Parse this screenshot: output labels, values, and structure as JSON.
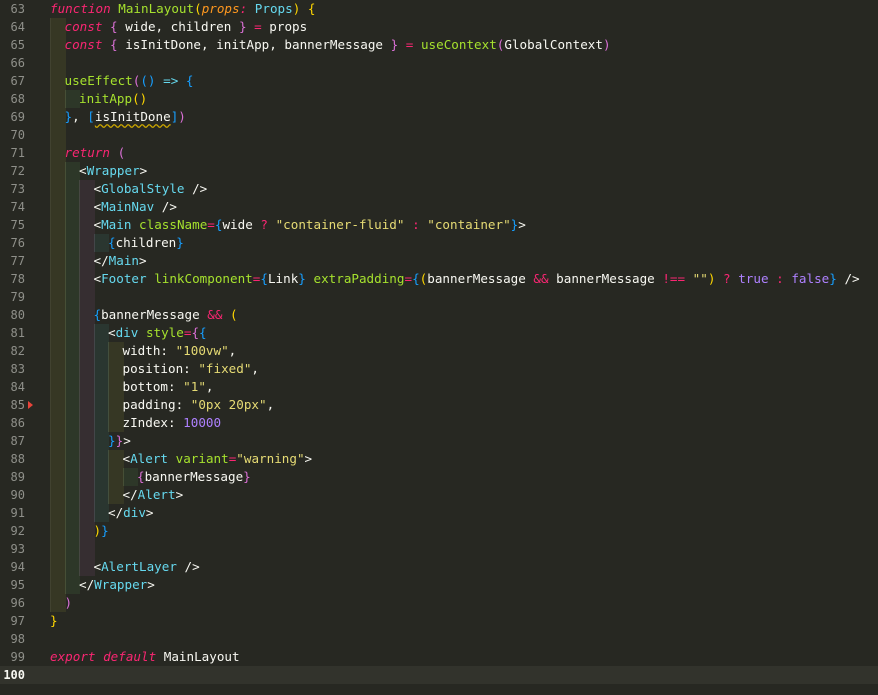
{
  "editor": {
    "theme_colors": {
      "background": "#272822",
      "keyword": "#f92672",
      "function": "#a6e22e",
      "type": "#66d9ef",
      "string": "#e6db74",
      "number": "#ae81ff",
      "parameter": "#fd971f",
      "bracket_gold": "#ffd700",
      "bracket_pink": "#da70d6",
      "bracket_blue": "#179fff"
    },
    "current_line": 100,
    "breakpoint_line": 85,
    "lines": [
      {
        "num": "63",
        "indent": 0,
        "tokens": [
          [
            "kw",
            "function"
          ],
          [
            "tx",
            " "
          ],
          [
            "fn",
            "MainLayout"
          ],
          [
            "b1",
            "("
          ],
          [
            "it",
            "props"
          ],
          [
            "kw",
            ":"
          ],
          [
            "tx",
            " "
          ],
          [
            "tn",
            "Props"
          ],
          [
            "b1",
            ")"
          ],
          [
            "tx",
            " "
          ],
          [
            "b1",
            "{"
          ]
        ]
      },
      {
        "num": "64",
        "indent": 1,
        "tokens": [
          [
            "kw",
            "const"
          ],
          [
            "tx",
            " "
          ],
          [
            "b2",
            "{"
          ],
          [
            "tx",
            " wide, children "
          ],
          [
            "b2",
            "}"
          ],
          [
            "tx",
            " "
          ],
          [
            "op",
            "="
          ],
          [
            "tx",
            " props"
          ]
        ]
      },
      {
        "num": "65",
        "indent": 1,
        "tokens": [
          [
            "kw",
            "const"
          ],
          [
            "tx",
            " "
          ],
          [
            "b2",
            "{"
          ],
          [
            "tx",
            " isInitDone, initApp, bannerMessage "
          ],
          [
            "b2",
            "}"
          ],
          [
            "tx",
            " "
          ],
          [
            "op",
            "="
          ],
          [
            "tx",
            " "
          ],
          [
            "fn",
            "useContext"
          ],
          [
            "b2",
            "("
          ],
          [
            "tx",
            "GlobalContext"
          ],
          [
            "b2",
            ")"
          ]
        ]
      },
      {
        "num": "66",
        "indent": 1,
        "tokens": []
      },
      {
        "num": "67",
        "indent": 1,
        "tokens": [
          [
            "fn",
            "useEffect"
          ],
          [
            "b2",
            "("
          ],
          [
            "b3",
            "()"
          ],
          [
            "tx",
            " "
          ],
          [
            "kwn",
            "=>"
          ],
          [
            "tx",
            " "
          ],
          [
            "b3",
            "{"
          ]
        ]
      },
      {
        "num": "68",
        "indent": 2,
        "tokens": [
          [
            "fn",
            "initApp"
          ],
          [
            "b1",
            "()"
          ]
        ]
      },
      {
        "num": "69",
        "indent": 1,
        "tokens": [
          [
            "b3",
            "}"
          ],
          [
            "tx",
            ", "
          ],
          [
            "b3",
            "["
          ],
          [
            "sq",
            "isInitDone"
          ],
          [
            "b3",
            "]"
          ],
          [
            "b2",
            ")"
          ]
        ]
      },
      {
        "num": "70",
        "indent": 1,
        "tokens": []
      },
      {
        "num": "71",
        "indent": 1,
        "tokens": [
          [
            "kw",
            "return"
          ],
          [
            "tx",
            " "
          ],
          [
            "b2",
            "("
          ]
        ]
      },
      {
        "num": "72",
        "indent": 2,
        "tokens": [
          [
            "tx",
            "<"
          ],
          [
            "tn",
            "Wrapper"
          ],
          [
            "tx",
            ">"
          ]
        ]
      },
      {
        "num": "73",
        "indent": 3,
        "tokens": [
          [
            "tx",
            "<"
          ],
          [
            "tn",
            "GlobalStyle"
          ],
          [
            "tx",
            " />"
          ]
        ]
      },
      {
        "num": "74",
        "indent": 3,
        "tokens": [
          [
            "tx",
            "<"
          ],
          [
            "tn",
            "MainNav"
          ],
          [
            "tx",
            " />"
          ]
        ]
      },
      {
        "num": "75",
        "indent": 3,
        "tokens": [
          [
            "tx",
            "<"
          ],
          [
            "tn",
            "Main"
          ],
          [
            "tx",
            " "
          ],
          [
            "fn",
            "className"
          ],
          [
            "op",
            "="
          ],
          [
            "b3",
            "{"
          ],
          [
            "tx",
            "wide "
          ],
          [
            "op",
            "?"
          ],
          [
            "tx",
            " "
          ],
          [
            "st",
            "\"container-fluid\""
          ],
          [
            "tx",
            " "
          ],
          [
            "op",
            ":"
          ],
          [
            "tx",
            " "
          ],
          [
            "st",
            "\"container\""
          ],
          [
            "b3",
            "}"
          ],
          [
            "tx",
            ">"
          ]
        ]
      },
      {
        "num": "76",
        "indent": 4,
        "tokens": [
          [
            "b3",
            "{"
          ],
          [
            "tx",
            "children"
          ],
          [
            "b3",
            "}"
          ]
        ]
      },
      {
        "num": "77",
        "indent": 3,
        "tokens": [
          [
            "tx",
            "</"
          ],
          [
            "tn",
            "Main"
          ],
          [
            "tx",
            ">"
          ]
        ]
      },
      {
        "num": "78",
        "indent": 3,
        "tokens": [
          [
            "tx",
            "<"
          ],
          [
            "tn",
            "Footer"
          ],
          [
            "tx",
            " "
          ],
          [
            "fn",
            "linkComponent"
          ],
          [
            "op",
            "="
          ],
          [
            "b3",
            "{"
          ],
          [
            "tx",
            "Link"
          ],
          [
            "b3",
            "}"
          ],
          [
            "tx",
            " "
          ],
          [
            "fn",
            "extraPadding"
          ],
          [
            "op",
            "="
          ],
          [
            "b3",
            "{"
          ],
          [
            "b1",
            "("
          ],
          [
            "tx",
            "bannerMessage "
          ],
          [
            "op",
            "&&"
          ],
          [
            "tx",
            " bannerMessage "
          ],
          [
            "op",
            "!=="
          ],
          [
            "tx",
            " "
          ],
          [
            "st",
            "\"\""
          ],
          [
            "b1",
            ")"
          ],
          [
            "tx",
            " "
          ],
          [
            "op",
            "?"
          ],
          [
            "tx",
            " "
          ],
          [
            "nm",
            "true"
          ],
          [
            "tx",
            " "
          ],
          [
            "op",
            ":"
          ],
          [
            "tx",
            " "
          ],
          [
            "nm",
            "false"
          ],
          [
            "b3",
            "}"
          ],
          [
            "tx",
            " />"
          ]
        ]
      },
      {
        "num": "79",
        "indent": 3,
        "tokens": []
      },
      {
        "num": "80",
        "indent": 3,
        "tokens": [
          [
            "b3",
            "{"
          ],
          [
            "tx",
            "bannerMessage "
          ],
          [
            "op",
            "&&"
          ],
          [
            "tx",
            " "
          ],
          [
            "b1",
            "("
          ]
        ]
      },
      {
        "num": "81",
        "indent": 4,
        "tokens": [
          [
            "tx",
            "<"
          ],
          [
            "tn",
            "div"
          ],
          [
            "tx",
            " "
          ],
          [
            "fn",
            "style"
          ],
          [
            "op",
            "="
          ],
          [
            "b2",
            "{"
          ],
          [
            "b3",
            "{"
          ]
        ]
      },
      {
        "num": "82",
        "indent": 5,
        "tokens": [
          [
            "tx",
            "width: "
          ],
          [
            "st",
            "\"100vw\""
          ],
          [
            "tx",
            ","
          ]
        ]
      },
      {
        "num": "83",
        "indent": 5,
        "tokens": [
          [
            "tx",
            "position: "
          ],
          [
            "st",
            "\"fixed\""
          ],
          [
            "tx",
            ","
          ]
        ]
      },
      {
        "num": "84",
        "indent": 5,
        "tokens": [
          [
            "tx",
            "bottom: "
          ],
          [
            "st",
            "\"1\""
          ],
          [
            "tx",
            ","
          ]
        ]
      },
      {
        "num": "85",
        "indent": 5,
        "tokens": [
          [
            "tx",
            "padding: "
          ],
          [
            "st",
            "\"0px 20px\""
          ],
          [
            "tx",
            ","
          ]
        ]
      },
      {
        "num": "86",
        "indent": 5,
        "tokens": [
          [
            "tx",
            "zIndex: "
          ],
          [
            "nm",
            "10000"
          ]
        ]
      },
      {
        "num": "87",
        "indent": 4,
        "tokens": [
          [
            "b3",
            "}"
          ],
          [
            "b2",
            "}"
          ],
          [
            "tx",
            ">"
          ]
        ]
      },
      {
        "num": "88",
        "indent": 5,
        "tokens": [
          [
            "tx",
            "<"
          ],
          [
            "tn",
            "Alert"
          ],
          [
            "tx",
            " "
          ],
          [
            "fn",
            "variant"
          ],
          [
            "op",
            "="
          ],
          [
            "st",
            "\"warning\""
          ],
          [
            "tx",
            ">"
          ]
        ]
      },
      {
        "num": "89",
        "indent": 6,
        "tokens": [
          [
            "b2",
            "{"
          ],
          [
            "tx",
            "bannerMessage"
          ],
          [
            "b2",
            "}"
          ]
        ]
      },
      {
        "num": "90",
        "indent": 5,
        "tokens": [
          [
            "tx",
            "</"
          ],
          [
            "tn",
            "Alert"
          ],
          [
            "tx",
            ">"
          ]
        ]
      },
      {
        "num": "91",
        "indent": 4,
        "tokens": [
          [
            "tx",
            "</"
          ],
          [
            "tn",
            "div"
          ],
          [
            "tx",
            ">"
          ]
        ]
      },
      {
        "num": "92",
        "indent": 3,
        "tokens": [
          [
            "b1",
            ")"
          ],
          [
            "b3",
            "}"
          ]
        ]
      },
      {
        "num": "93",
        "indent": 3,
        "tokens": []
      },
      {
        "num": "94",
        "indent": 3,
        "tokens": [
          [
            "tx",
            "<"
          ],
          [
            "tn",
            "AlertLayer"
          ],
          [
            "tx",
            " />"
          ]
        ]
      },
      {
        "num": "95",
        "indent": 2,
        "tokens": [
          [
            "tx",
            "</"
          ],
          [
            "tn",
            "Wrapper"
          ],
          [
            "tx",
            ">"
          ]
        ]
      },
      {
        "num": "96",
        "indent": 1,
        "tokens": [
          [
            "b2",
            ")"
          ]
        ]
      },
      {
        "num": "97",
        "indent": 0,
        "tokens": [
          [
            "b1",
            "}"
          ]
        ]
      },
      {
        "num": "98",
        "indent": 0,
        "tokens": []
      },
      {
        "num": "99",
        "indent": 0,
        "tokens": [
          [
            "kw",
            "export"
          ],
          [
            "tx",
            " "
          ],
          [
            "kw",
            "default"
          ],
          [
            "tx",
            " MainLayout"
          ]
        ]
      },
      {
        "num": "100",
        "indent": 0,
        "tokens": []
      }
    ]
  }
}
